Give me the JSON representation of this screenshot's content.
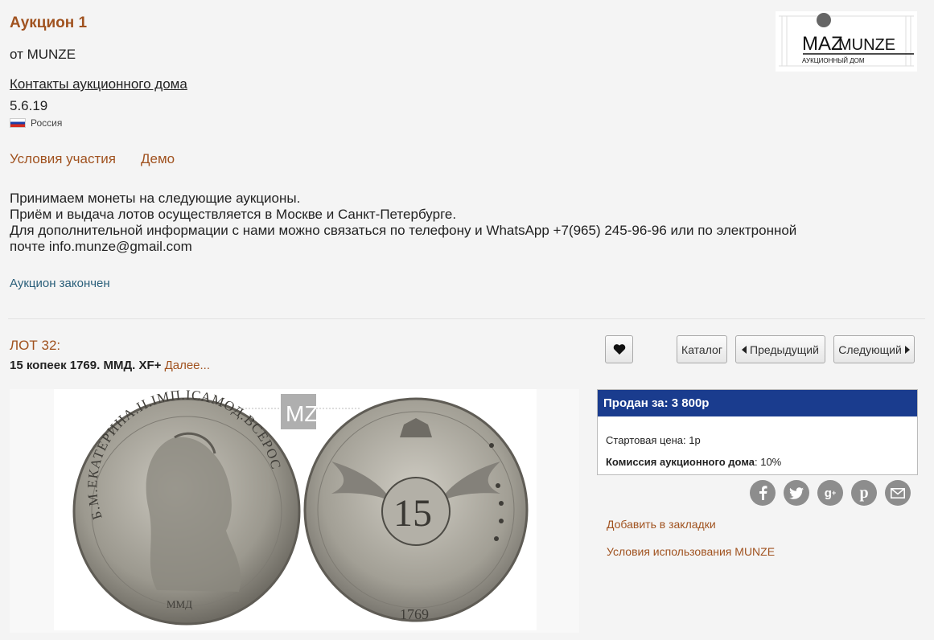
{
  "auction": {
    "title": "Аукцион 1",
    "from": "от MUNZE",
    "contacts": "Контакты аукционного дома",
    "date": "5.6.19",
    "country": "Россия",
    "links": [
      "Условия участия",
      "Демо"
    ],
    "description": [
      "Принимаем монеты на следующие аукционы.",
      "Приём и выдача лотов осуществляется в Москве и Санкт-Петербурге.",
      "Для дополнительной информации с нами можно связаться по телефону и WhatsApp +7(965) 245-96-96 или по электронной",
      "почте info.munze@gmail.com"
    ],
    "status": "Аукцион закончен"
  },
  "logo": {
    "brand": "MUNZE",
    "mark": "MAZ",
    "subtitle": "АУКЦИОННЫЙ ДОМ"
  },
  "lot": {
    "number_label": "ЛОТ 32:",
    "name": "15 копеек 1769. ММД. XF+",
    "more": "Далее..."
  },
  "nav": {
    "catalog": "Каталог",
    "prev": "Предыдущий",
    "next": "Следующий"
  },
  "sale": {
    "sold_label": "Продан за: 3 800р",
    "start_label": "Стартовая цена: ",
    "start_value": "1р",
    "commission_label": "Комиссия аукционного дома",
    "commission_value": ": 10%"
  },
  "social": [
    "facebook-icon",
    "twitter-icon",
    "google-plus-icon",
    "pinterest-icon",
    "mail-icon"
  ],
  "side_links": {
    "bookmark": "Добавить в закладки",
    "terms": "Условия использования MUNZE"
  },
  "coin": {
    "obverse_legend": "Б.М.ЕКАТЕРИНА.II.IМП.IСАМОД.ВСЕРОС",
    "reverse_denomination": "15",
    "mint": "ММД",
    "year": "1769",
    "watermark": "MZ"
  },
  "colors": {
    "accent": "#a0521f",
    "sold_bar": "#1a3c8e",
    "status": "#2a5f7a"
  }
}
